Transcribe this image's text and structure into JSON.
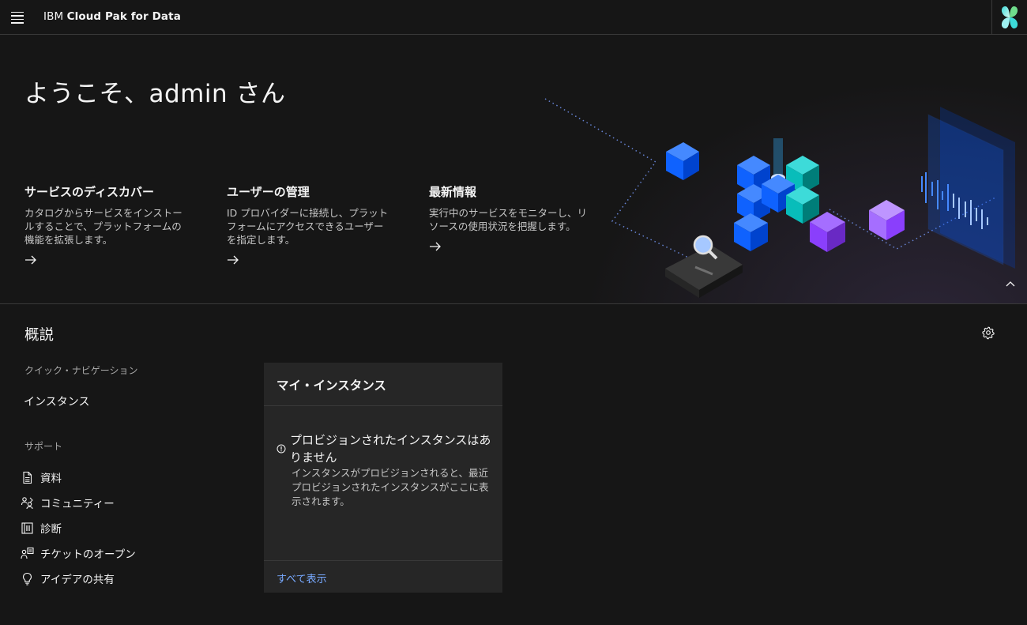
{
  "header": {
    "brand_prefix": "IBM",
    "brand_product": "Cloud Pak for Data",
    "menu_icon": "hamburger-menu-icon",
    "switcher_icon": "cloud-pak-logo-icon"
  },
  "hero": {
    "welcome": "ようこそ、admin さん",
    "tiles": [
      {
        "title": "サービスのディスカバー",
        "description": "カタログからサービスをインストールすることで、プラットフォームの機能を拡張します。"
      },
      {
        "title": "ユーザーの管理",
        "description": "ID プロバイダーに接続し、プラットフォームにアクセスできるユーザーを指定します。"
      },
      {
        "title": "最新情報",
        "description": "実行中のサービスをモニターし、リソースの使用状況を把握します。"
      }
    ]
  },
  "overview": {
    "title": "概説",
    "quick_nav": {
      "label": "クイック・ナビゲーション",
      "items": [
        "インスタンス"
      ]
    },
    "support": {
      "label": "サポート",
      "items": [
        {
          "label": "資料",
          "icon": "document-icon"
        },
        {
          "label": "コミュニティー",
          "icon": "community-icon"
        },
        {
          "label": "診断",
          "icon": "diagnostics-icon"
        },
        {
          "label": "チケットのオープン",
          "icon": "ticket-icon"
        },
        {
          "label": "アイデアの共有",
          "icon": "lightbulb-icon"
        }
      ]
    },
    "card": {
      "title": "マイ・インスタンス",
      "empty_title": "プロビジョンされたインスタンスはありません",
      "empty_description": "インスタンスがプロビジョンされると、最近プロビジョンされたインスタンスがここに表示されます。",
      "link": "すべて表示"
    }
  },
  "colors": {
    "background": "#161616",
    "card": "#262626",
    "link": "#78a9ff",
    "accent_blue": "#0f62fe",
    "accent_teal": "#08bdba",
    "accent_purple": "#8a3ffc"
  }
}
